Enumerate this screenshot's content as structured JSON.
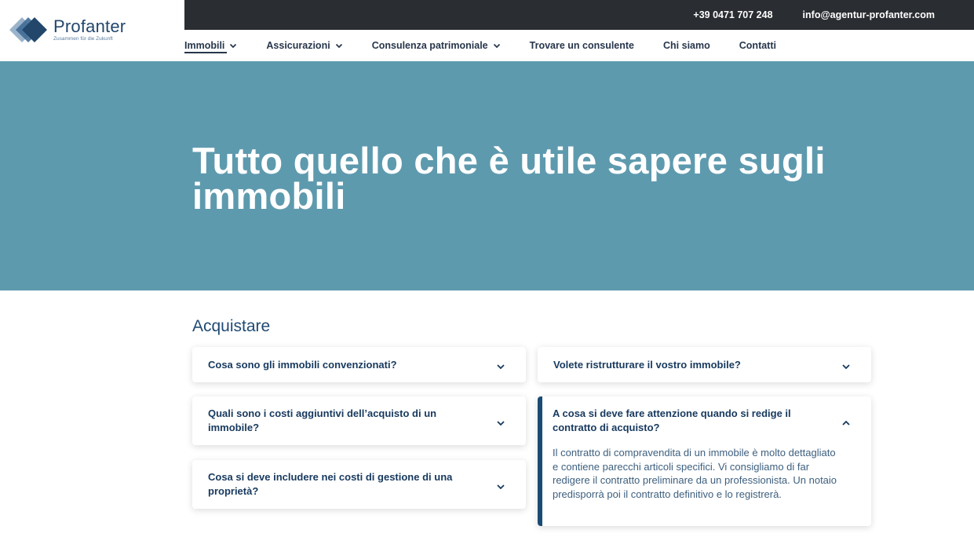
{
  "brand": {
    "name": "Profanter",
    "tagline": "Zusammen für die Zukunft",
    "colors": {
      "dark": "#22476b",
      "mid": "#3f6a93",
      "light": "#8aa6c1"
    }
  },
  "topbar": {
    "phone": "+39 0471 707 248",
    "email": "info@agentur-profanter.com"
  },
  "nav": {
    "items": [
      {
        "label": "Immobili",
        "has_dropdown": true,
        "active": true
      },
      {
        "label": "Assicurazioni",
        "has_dropdown": true,
        "active": false
      },
      {
        "label": "Consulenza patrimoniale",
        "has_dropdown": true,
        "active": false
      },
      {
        "label": "Trovare un consulente",
        "has_dropdown": false,
        "active": false
      },
      {
        "label": "Chi siamo",
        "has_dropdown": false,
        "active": false
      },
      {
        "label": "Contatti",
        "has_dropdown": false,
        "active": false
      }
    ]
  },
  "hero": {
    "title": "Tutto quello che è utile sapere sugli immobili",
    "background": "#5e9aae"
  },
  "section": {
    "title": "Acquistare",
    "faqs": [
      {
        "question": "Cosa sono gli immobili convenzionati?",
        "expanded": false,
        "icon": "chevron-down-icon"
      },
      {
        "question": "Quali sono i costi aggiuntivi dell’acquisto di un immobile?",
        "expanded": false,
        "icon": "chevron-down-icon"
      },
      {
        "question": "Cosa si deve includere nei costi di gestione di una proprietà?",
        "expanded": false,
        "icon": "chevron-down-icon"
      },
      {
        "question": "Volete ristrutturare il vostro immobile?",
        "expanded": false,
        "icon": "chevron-down-icon"
      },
      {
        "question": "A cosa si deve fare attenzione quando si redige il contratto di acquisto?",
        "expanded": true,
        "icon": "chevron-up-icon",
        "answer": "Il contratto di compravendita di un immobile è molto dettagliato e contiene parecchi articoli specifici. Vi consigliamo di far redigere il contratto preliminare da un professionista. Un notaio predisporrà poi il contratto definitivo e lo registrerà."
      }
    ]
  }
}
